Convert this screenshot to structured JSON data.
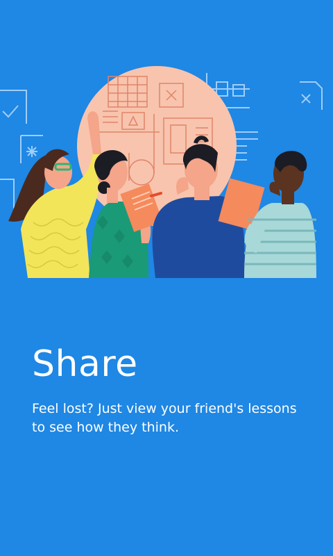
{
  "slide": {
    "title": "Share",
    "description": "Feel lost? Just view your friend's lessons to see how they think."
  },
  "colors": {
    "background": "#1f87e4",
    "circle": "#f8c4ad",
    "text": "#ffffff"
  },
  "illustration": {
    "people": [
      "woman-yellow-shirt",
      "woman-green-dress",
      "man-blue-sweater",
      "man-striped-shirt"
    ]
  }
}
